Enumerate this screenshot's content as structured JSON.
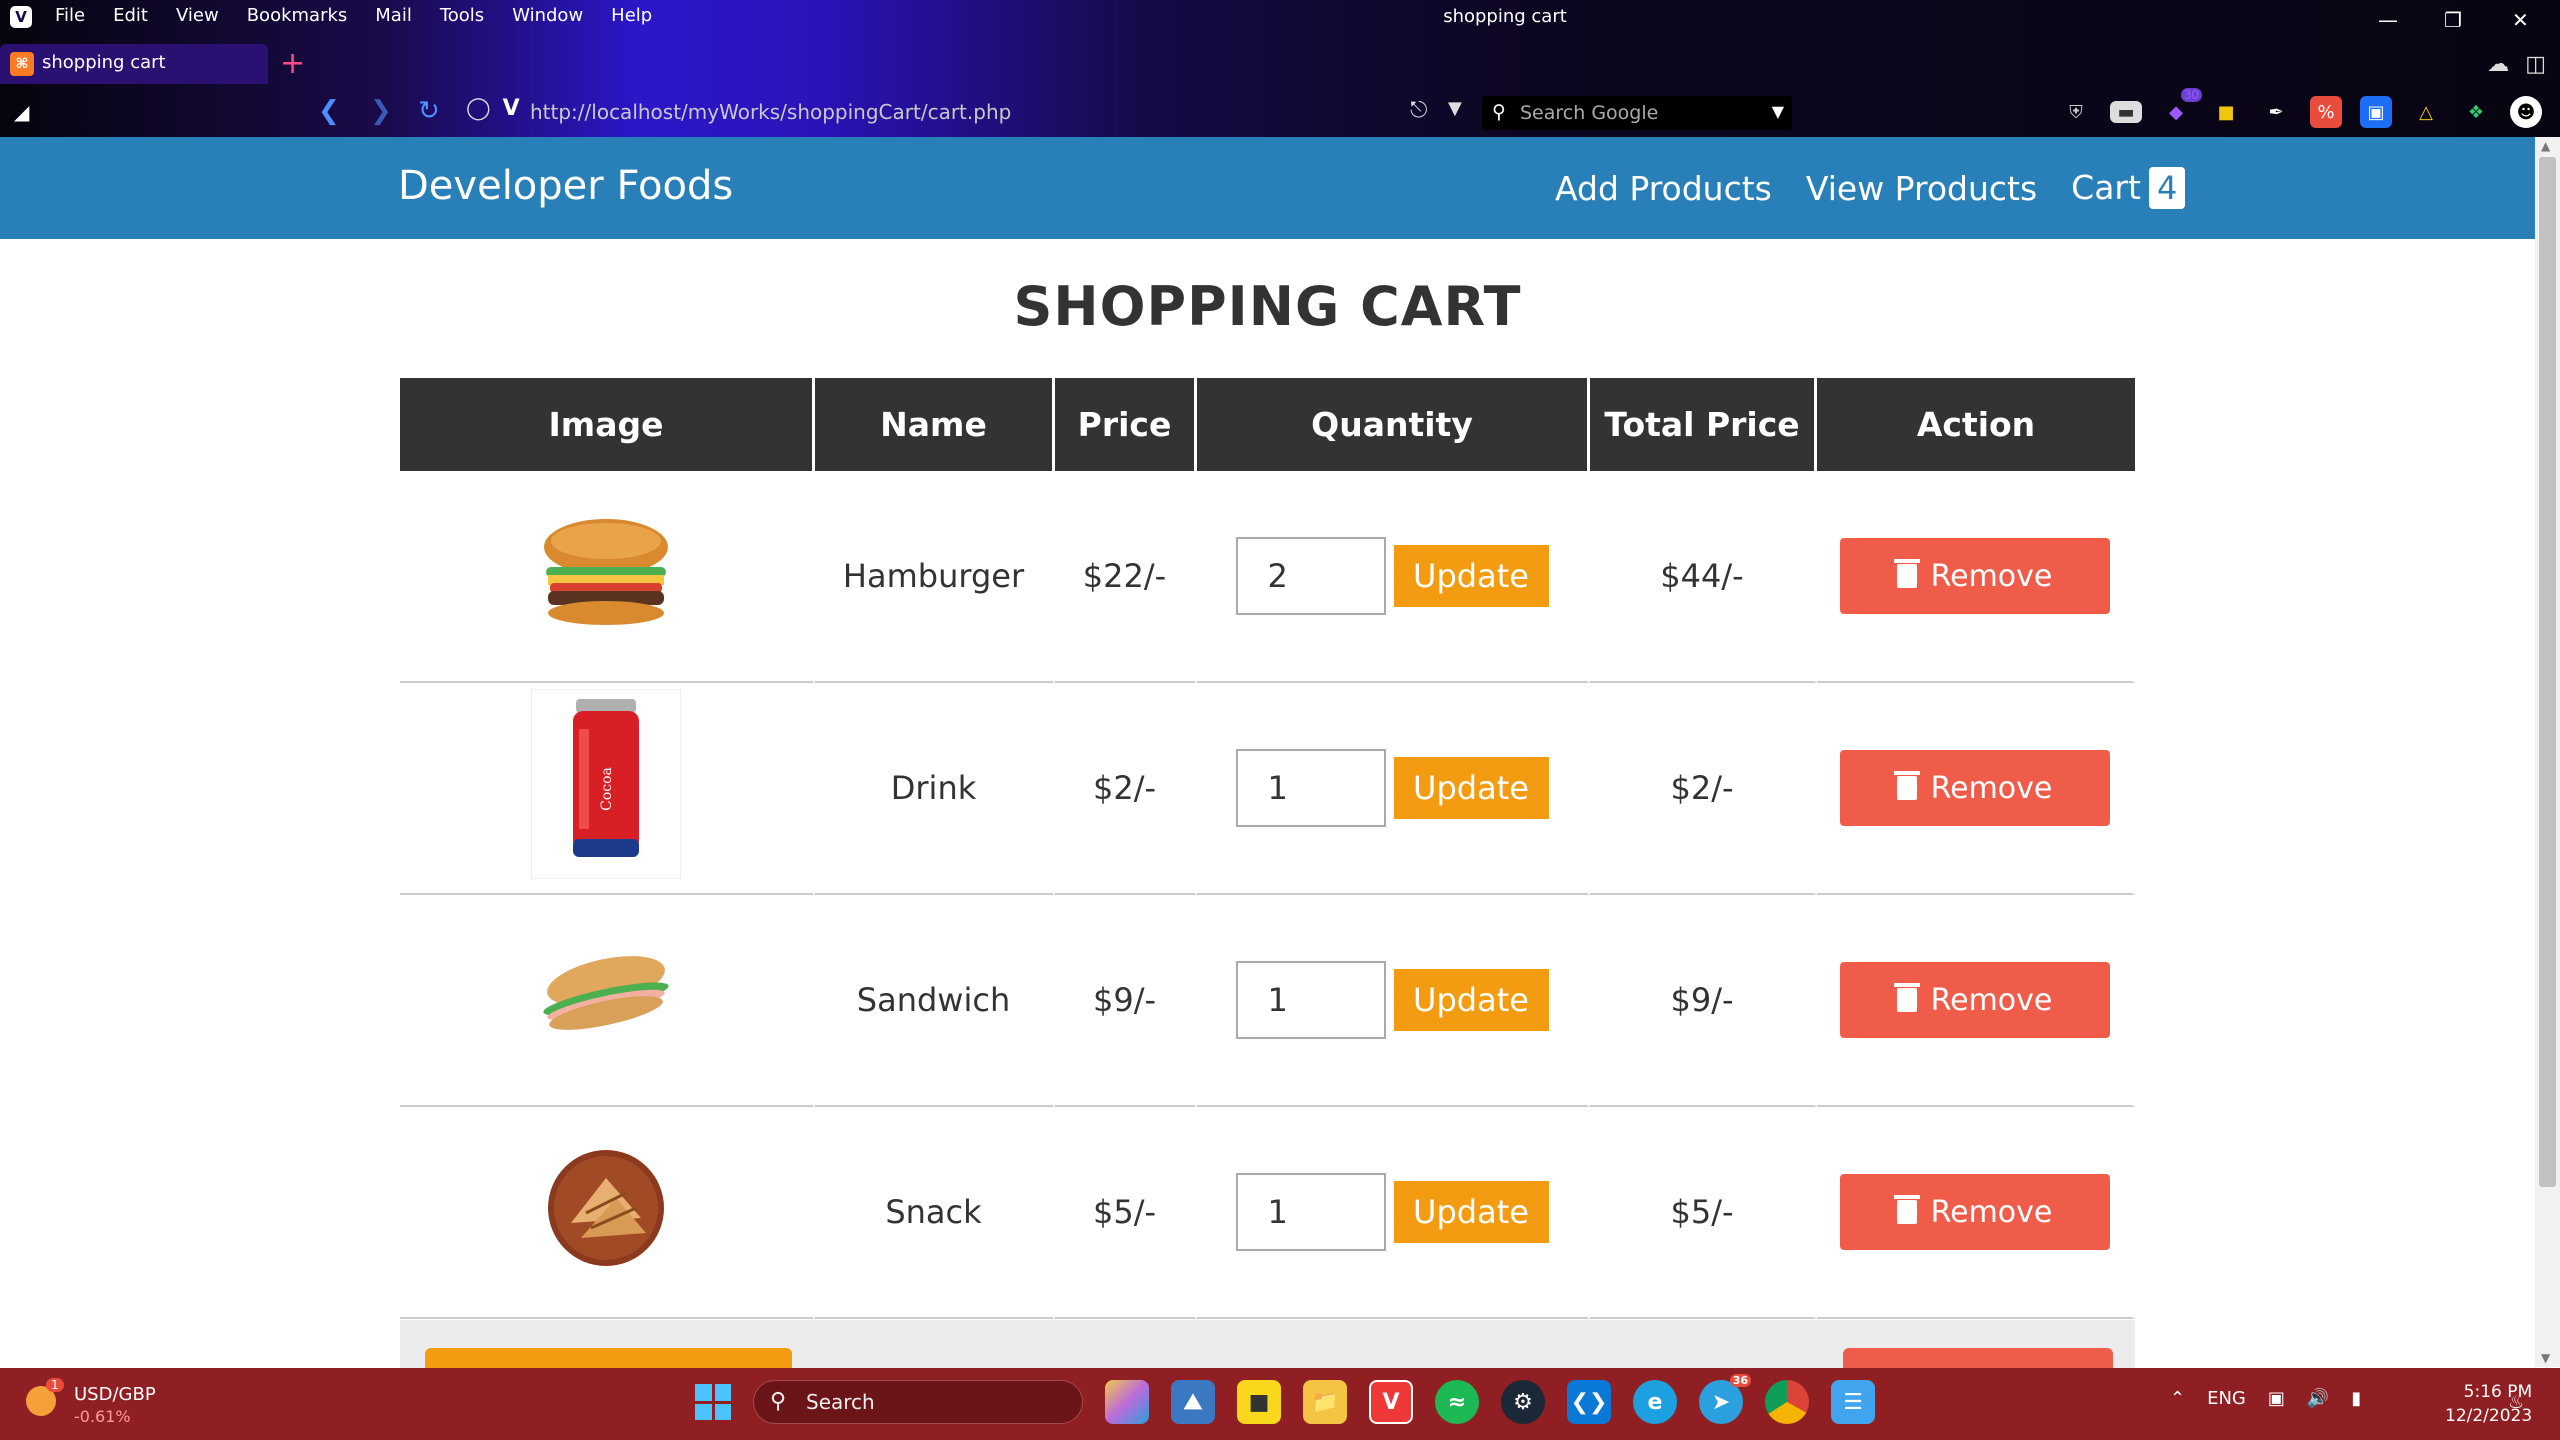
{
  "browser": {
    "menu_items": [
      "File",
      "Edit",
      "View",
      "Bookmarks",
      "Mail",
      "Tools",
      "Window",
      "Help"
    ],
    "window_title": "shopping cart",
    "tab_title": "shopping cart",
    "url": "http://localhost/myWorks/shoppingCart/cart.php",
    "search_placeholder": "Search Google",
    "extension_badge": "30"
  },
  "site": {
    "brand": "Developer Foods",
    "nav": {
      "add_products": "Add Products",
      "view_products": "View Products",
      "cart": "Cart",
      "cart_count": "4"
    },
    "heading": "SHOPPING CART",
    "table": {
      "headers": [
        "Image",
        "Name",
        "Price",
        "Quantity",
        "Total Price",
        "Action"
      ],
      "rows": [
        {
          "image": "hamburger",
          "name": "Hamburger",
          "price": "$22/-",
          "quantity": "2",
          "total": "$44/-"
        },
        {
          "image": "drink",
          "name": "Drink",
          "price": "$2/-",
          "quantity": "1",
          "total": "$2/-"
        },
        {
          "image": "sandwich",
          "name": "Sandwich",
          "price": "$9/-",
          "quantity": "1",
          "total": "$9/-"
        },
        {
          "image": "snack",
          "name": "Snack",
          "price": "$5/-",
          "quantity": "1",
          "total": "$5/-"
        }
      ],
      "update_label": "Update",
      "remove_label": "Remove"
    }
  },
  "taskbar": {
    "ticker_symbol": "USD/GBP",
    "ticker_change": "-0.61%",
    "ticker_badge": "1",
    "search_label": "Search",
    "language": "ENG",
    "time": "5:16 PM",
    "date": "12/2/2023",
    "telegram_badge": "36"
  }
}
